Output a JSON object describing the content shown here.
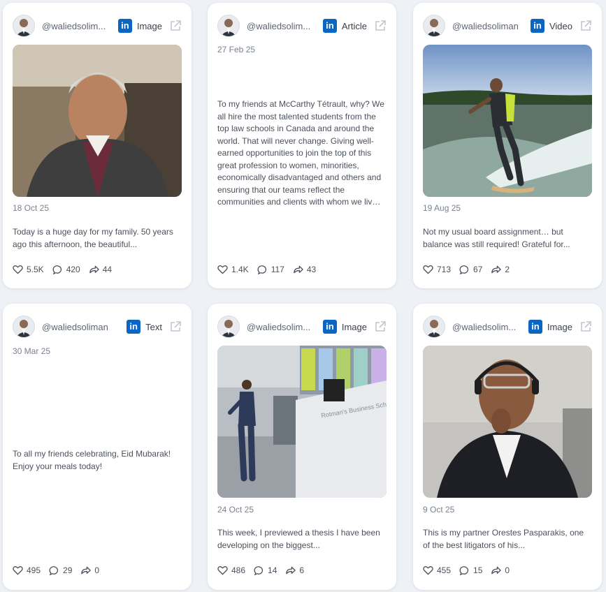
{
  "posts": [
    {
      "handle": "@waliedsolim...",
      "type": "Image",
      "date": "18 Oct 25",
      "text": "Today is a huge day for my family. 50 years ago this afternoon, the beautiful...",
      "likes": "5.5K",
      "comments": "420",
      "shares": "44"
    },
    {
      "handle": "@waliedsolim...",
      "type": "Article",
      "date": "27 Feb 25",
      "text": "To my friends at McCarthy Tétrault, why? We all hire the most talented students from the top law schools in Canada and around the world. That will never change. Giving well-earned opportunities to join the top of this great profession to women, minorities, economically disadvantaged and others and ensuring that our teams reflect the communities and clients with whom we live and have...",
      "likes": "1.4K",
      "comments": "117",
      "shares": "43"
    },
    {
      "handle": "@waliedsoliman",
      "type": "Video",
      "date": "19 Aug 25",
      "text": "Not my usual board assignment… but balance was still required! Grateful for...",
      "likes": "713",
      "comments": "67",
      "shares": "2"
    },
    {
      "handle": "@waliedsoliman",
      "type": "Text",
      "date": "30 Mar 25",
      "text": "To all my friends celebrating, Eid Mubarak! Enjoy your meals today!",
      "likes": "495",
      "comments": "29",
      "shares": "0"
    },
    {
      "handle": "@waliedsolim...",
      "type": "Image",
      "date": "24 Oct 25",
      "text": "This week, I previewed a thesis I have been developing on the biggest...",
      "image_caption": "Rotman's Business School",
      "likes": "486",
      "comments": "14",
      "shares": "6"
    },
    {
      "handle": "@waliedsolim...",
      "type": "Image",
      "date": "9 Oct 25",
      "text": "This is my partner Orestes Pasparakis, one of the best litigators of his...",
      "likes": "455",
      "comments": "15",
      "shares": "0"
    }
  ],
  "icons": {
    "platform": "linkedin-icon",
    "external": "external-link-icon",
    "like": "heart-icon",
    "comment": "comment-icon",
    "share": "share-icon"
  },
  "colors": {
    "linkedin": "#0a66c2",
    "background": "#eef1f5",
    "card": "#ffffff"
  }
}
